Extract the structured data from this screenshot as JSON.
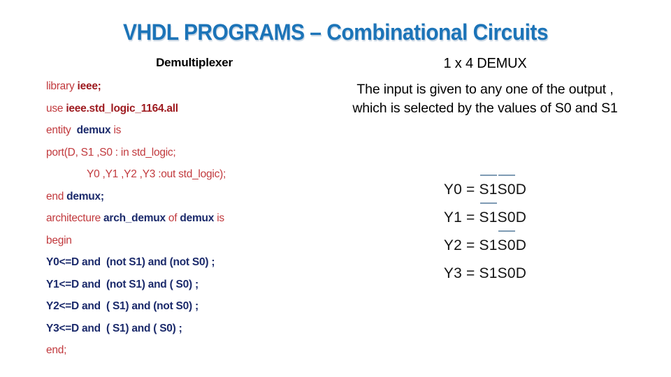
{
  "slide": {
    "title": "VHDL PROGRAMS – Combinational Circuits",
    "title_color": "#1c74b8",
    "background_color": "#ffffff"
  },
  "code_panel": {
    "heading": "Demultiplexer",
    "red_color": "#c1393d",
    "dark_red_color": "#9e1b20",
    "navy_color": "#1b2a6b",
    "lines": [
      {
        "segments": [
          {
            "t": "library ",
            "s": "kw"
          },
          {
            "t": "ieee;",
            "s": "kwb"
          }
        ]
      },
      {
        "segments": [
          {
            "t": "use ",
            "s": "kw"
          },
          {
            "t": "ieee.std_logic_1164.all",
            "s": "kwb"
          }
        ]
      },
      {
        "segments": [
          {
            "t": "entity  ",
            "s": "kw"
          },
          {
            "t": "demux",
            "s": "navy"
          },
          {
            "t": " is",
            "s": "kw"
          }
        ]
      },
      {
        "segments": [
          {
            "t": "port(D, S1 ,S0 : in std_logic;",
            "s": "kw"
          }
        ]
      },
      {
        "indent": true,
        "segments": [
          {
            "t": "Y0 ,Y1 ,Y2 ,Y3 :out std_logic);",
            "s": "kw"
          }
        ]
      },
      {
        "segments": [
          {
            "t": "end ",
            "s": "kw"
          },
          {
            "t": "demux;",
            "s": "navy"
          }
        ]
      },
      {
        "segments": [
          {
            "t": "architecture ",
            "s": "kw"
          },
          {
            "t": "arch_demux",
            "s": "navy"
          },
          {
            "t": " of ",
            "s": "kw"
          },
          {
            "t": "demux",
            "s": "navy"
          },
          {
            "t": " is",
            "s": "kw"
          }
        ]
      },
      {
        "segments": [
          {
            "t": "begin",
            "s": "kw"
          }
        ]
      },
      {
        "navyline": true,
        "segments": [
          {
            "t": "Y0<=D and  (not S1) and (not S0) ;",
            "s": "navy"
          }
        ]
      },
      {
        "navyline": true,
        "segments": [
          {
            "t": "Y1<=D and  (not S1) and ( S0) ;",
            "s": "navy"
          }
        ]
      },
      {
        "navyline": true,
        "segments": [
          {
            "t": "Y2<=D and  ( S1) and (not S0) ;",
            "s": "navy"
          }
        ]
      },
      {
        "navyline": true,
        "segments": [
          {
            "t": "Y3<=D and  ( S1) and ( S0) ;",
            "s": "navy"
          }
        ]
      },
      {
        "segments": [
          {
            "t": "end;",
            "s": "kw"
          }
        ]
      }
    ]
  },
  "explain_panel": {
    "title": "1 x 4 DEMUX",
    "description": "The input is given to any one of the output , which is selected by the values of S0 and S1",
    "overbar_color": "#7e9bb4",
    "equations": [
      {
        "lhs": "Y0 = ",
        "terms": [
          {
            "t": "S1",
            "bar": true
          },
          {
            "t": "S0",
            "bar": true
          },
          {
            "t": "D",
            "bar": false
          }
        ]
      },
      {
        "lhs": "Y1 = ",
        "terms": [
          {
            "t": "S1",
            "bar": true
          },
          {
            "t": "S0",
            "bar": false
          },
          {
            "t": "D",
            "bar": false
          }
        ]
      },
      {
        "lhs": "Y2 = ",
        "terms": [
          {
            "t": "S1",
            "bar": false
          },
          {
            "t": "S0",
            "bar": true
          },
          {
            "t": "D",
            "bar": false
          }
        ]
      },
      {
        "lhs": "Y3 = ",
        "terms": [
          {
            "t": "S1",
            "bar": false
          },
          {
            "t": "S0",
            "bar": false
          },
          {
            "t": "D",
            "bar": false
          }
        ]
      }
    ]
  }
}
